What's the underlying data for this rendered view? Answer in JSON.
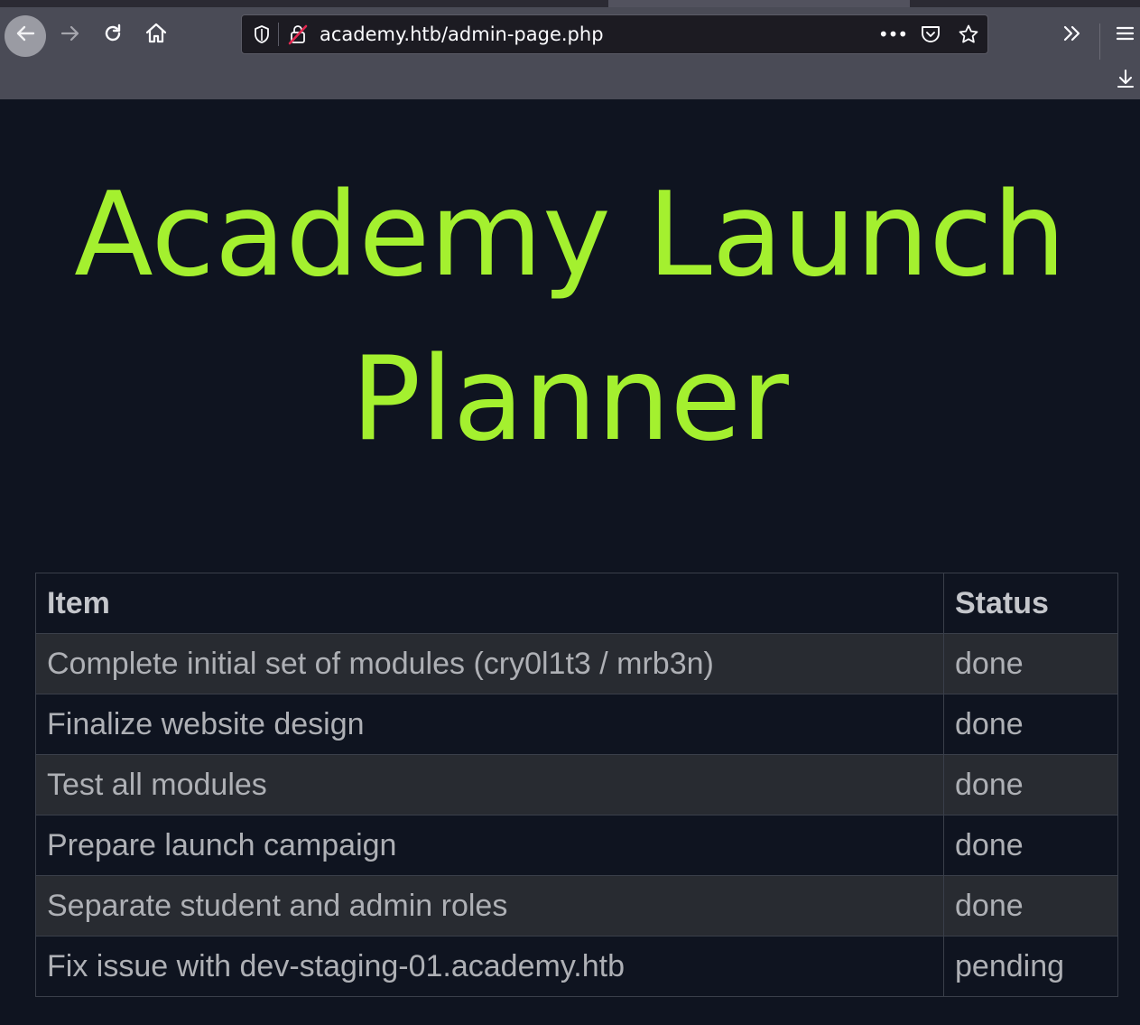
{
  "browser": {
    "url": "academy.htb/admin-page.php"
  },
  "page": {
    "title": "Academy Launch Planner"
  },
  "table": {
    "headers": [
      "Item",
      "Status"
    ],
    "rows": [
      {
        "item": "Complete initial set of modules (cry0l1t3 / mrb3n)",
        "status": "done"
      },
      {
        "item": "Finalize website design",
        "status": "done"
      },
      {
        "item": "Test all modules",
        "status": "done"
      },
      {
        "item": "Prepare launch campaign",
        "status": "done"
      },
      {
        "item": "Separate student and admin roles",
        "status": "done"
      },
      {
        "item": "Fix issue with dev-staging-01.academy.htb",
        "status": "pending"
      }
    ]
  },
  "colors": {
    "title": "#a4f02f",
    "background": "#0f1420",
    "stripe": "#282b31"
  },
  "icons": [
    "back-arrow-icon",
    "forward-arrow-icon",
    "reload-icon",
    "home-icon",
    "shield-icon",
    "insecure-lock-icon",
    "more-icon",
    "pocket-icon",
    "star-icon",
    "overflow-chevron-icon",
    "hamburger-menu-icon",
    "download-icon"
  ]
}
